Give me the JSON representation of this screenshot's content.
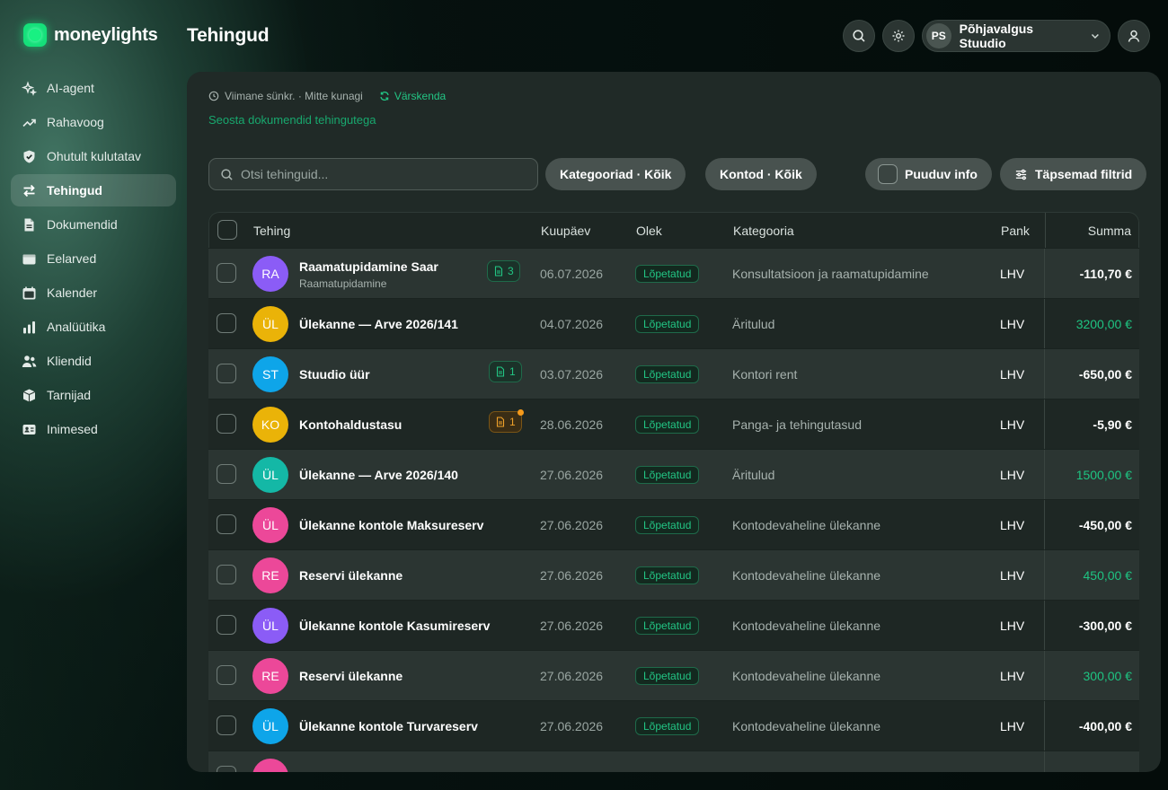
{
  "app": {
    "logo_text": "moneylights",
    "page_title": "Tehingud"
  },
  "sidebar": {
    "items": [
      {
        "label": "AI-agent",
        "icon": "sparkles-icon",
        "active": false
      },
      {
        "label": "Rahavoog",
        "icon": "trend-up-icon",
        "active": false
      },
      {
        "label": "Ohutult kulutatav",
        "icon": "shield-icon",
        "active": false
      },
      {
        "label": "Tehingud",
        "icon": "swap-arrows-icon",
        "active": true
      },
      {
        "label": "Dokumendid",
        "icon": "document-icon",
        "active": false
      },
      {
        "label": "Eelarved",
        "icon": "wallet-icon",
        "active": false
      },
      {
        "label": "Kalender",
        "icon": "calendar-icon",
        "active": false
      },
      {
        "label": "Analüütika",
        "icon": "bar-chart-icon",
        "active": false
      },
      {
        "label": "Kliendid",
        "icon": "users-icon",
        "active": false
      },
      {
        "label": "Tarnijad",
        "icon": "box-icon",
        "active": false
      },
      {
        "label": "Inimesed",
        "icon": "id-card-icon",
        "active": false
      }
    ]
  },
  "header": {
    "org_initials": "PS",
    "org_name": "Põhjavalgus Stuudio"
  },
  "toolbar": {
    "sync_text": "Viimane sünkr. · Mitte kunagi",
    "refresh_label": "Värskenda",
    "link_documents": "Seosta dokumendid tehingutega",
    "search_placeholder": "Otsi tehinguid...",
    "filter_categories": "Kategooriad · Kõik",
    "filter_accounts": "Kontod · Kõik",
    "filter_missing": "Puuduv info",
    "filter_advanced": "Täpsemad filtrid"
  },
  "table": {
    "columns": {
      "transaction": "Tehing",
      "date": "Kuupäev",
      "status": "Olek",
      "category": "Kategooria",
      "bank": "Pank",
      "amount": "Summa"
    },
    "rows": [
      {
        "initials": "RA",
        "color": "#8b5cf6",
        "name": "Raamatupidamine Saar",
        "sub": "Raamatupidamine",
        "docs": "3",
        "doc_warn": false,
        "date": "06.07.2026",
        "status": "Lõpetatud",
        "category": "Konsultatsioon ja raamatupidamine",
        "bank": "LHV",
        "amount": "-110,70 €",
        "positive": false
      },
      {
        "initials": "ÜL",
        "color": "#eab308",
        "name": "Ülekanne — Arve 2026/141",
        "sub": "",
        "docs": "",
        "doc_warn": false,
        "date": "04.07.2026",
        "status": "Lõpetatud",
        "category": "Äritulud",
        "bank": "LHV",
        "amount": "3200,00 €",
        "positive": true
      },
      {
        "initials": "ST",
        "color": "#0ea5e9",
        "name": "Stuudio üür",
        "sub": "",
        "docs": "1",
        "doc_warn": false,
        "date": "03.07.2026",
        "status": "Lõpetatud",
        "category": "Kontori rent",
        "bank": "LHV",
        "amount": "-650,00 €",
        "positive": false
      },
      {
        "initials": "KO",
        "color": "#eab308",
        "name": "Kontohaldustasu",
        "sub": "",
        "docs": "1",
        "doc_warn": true,
        "date": "28.06.2026",
        "status": "Lõpetatud",
        "category": "Panga- ja tehingutasud",
        "bank": "LHV",
        "amount": "-5,90 €",
        "positive": false
      },
      {
        "initials": "ÜL",
        "color": "#14b8a6",
        "name": "Ülekanne — Arve 2026/140",
        "sub": "",
        "docs": "",
        "doc_warn": false,
        "date": "27.06.2026",
        "status": "Lõpetatud",
        "category": "Äritulud",
        "bank": "LHV",
        "amount": "1500,00 €",
        "positive": true
      },
      {
        "initials": "ÜL",
        "color": "#ec4899",
        "name": "Ülekanne kontole Maksureserv",
        "sub": "",
        "docs": "",
        "doc_warn": false,
        "date": "27.06.2026",
        "status": "Lõpetatud",
        "category": "Kontodevaheline ülekanne",
        "bank": "LHV",
        "amount": "-450,00 €",
        "positive": false
      },
      {
        "initials": "RE",
        "color": "#ec4899",
        "name": "Reservi ülekanne",
        "sub": "",
        "docs": "",
        "doc_warn": false,
        "date": "27.06.2026",
        "status": "Lõpetatud",
        "category": "Kontodevaheline ülekanne",
        "bank": "LHV",
        "amount": "450,00 €",
        "positive": true
      },
      {
        "initials": "ÜL",
        "color": "#8b5cf6",
        "name": "Ülekanne kontole Kasumireserv",
        "sub": "",
        "docs": "",
        "doc_warn": false,
        "date": "27.06.2026",
        "status": "Lõpetatud",
        "category": "Kontodevaheline ülekanne",
        "bank": "LHV",
        "amount": "-300,00 €",
        "positive": false
      },
      {
        "initials": "RE",
        "color": "#ec4899",
        "name": "Reservi ülekanne",
        "sub": "",
        "docs": "",
        "doc_warn": false,
        "date": "27.06.2026",
        "status": "Lõpetatud",
        "category": "Kontodevaheline ülekanne",
        "bank": "LHV",
        "amount": "300,00 €",
        "positive": true
      },
      {
        "initials": "ÜL",
        "color": "#0ea5e9",
        "name": "Ülekanne kontole Turvareserv",
        "sub": "",
        "docs": "",
        "doc_warn": false,
        "date": "27.06.2026",
        "status": "Lõpetatud",
        "category": "Kontodevaheline ülekanne",
        "bank": "LHV",
        "amount": "-400,00 €",
        "positive": false
      },
      {
        "initials": "",
        "color": "#ec4899",
        "name": "",
        "sub": "",
        "docs": "",
        "doc_warn": false,
        "date": "",
        "status": "",
        "category": "",
        "bank": "",
        "amount": "",
        "positive": false
      }
    ]
  }
}
